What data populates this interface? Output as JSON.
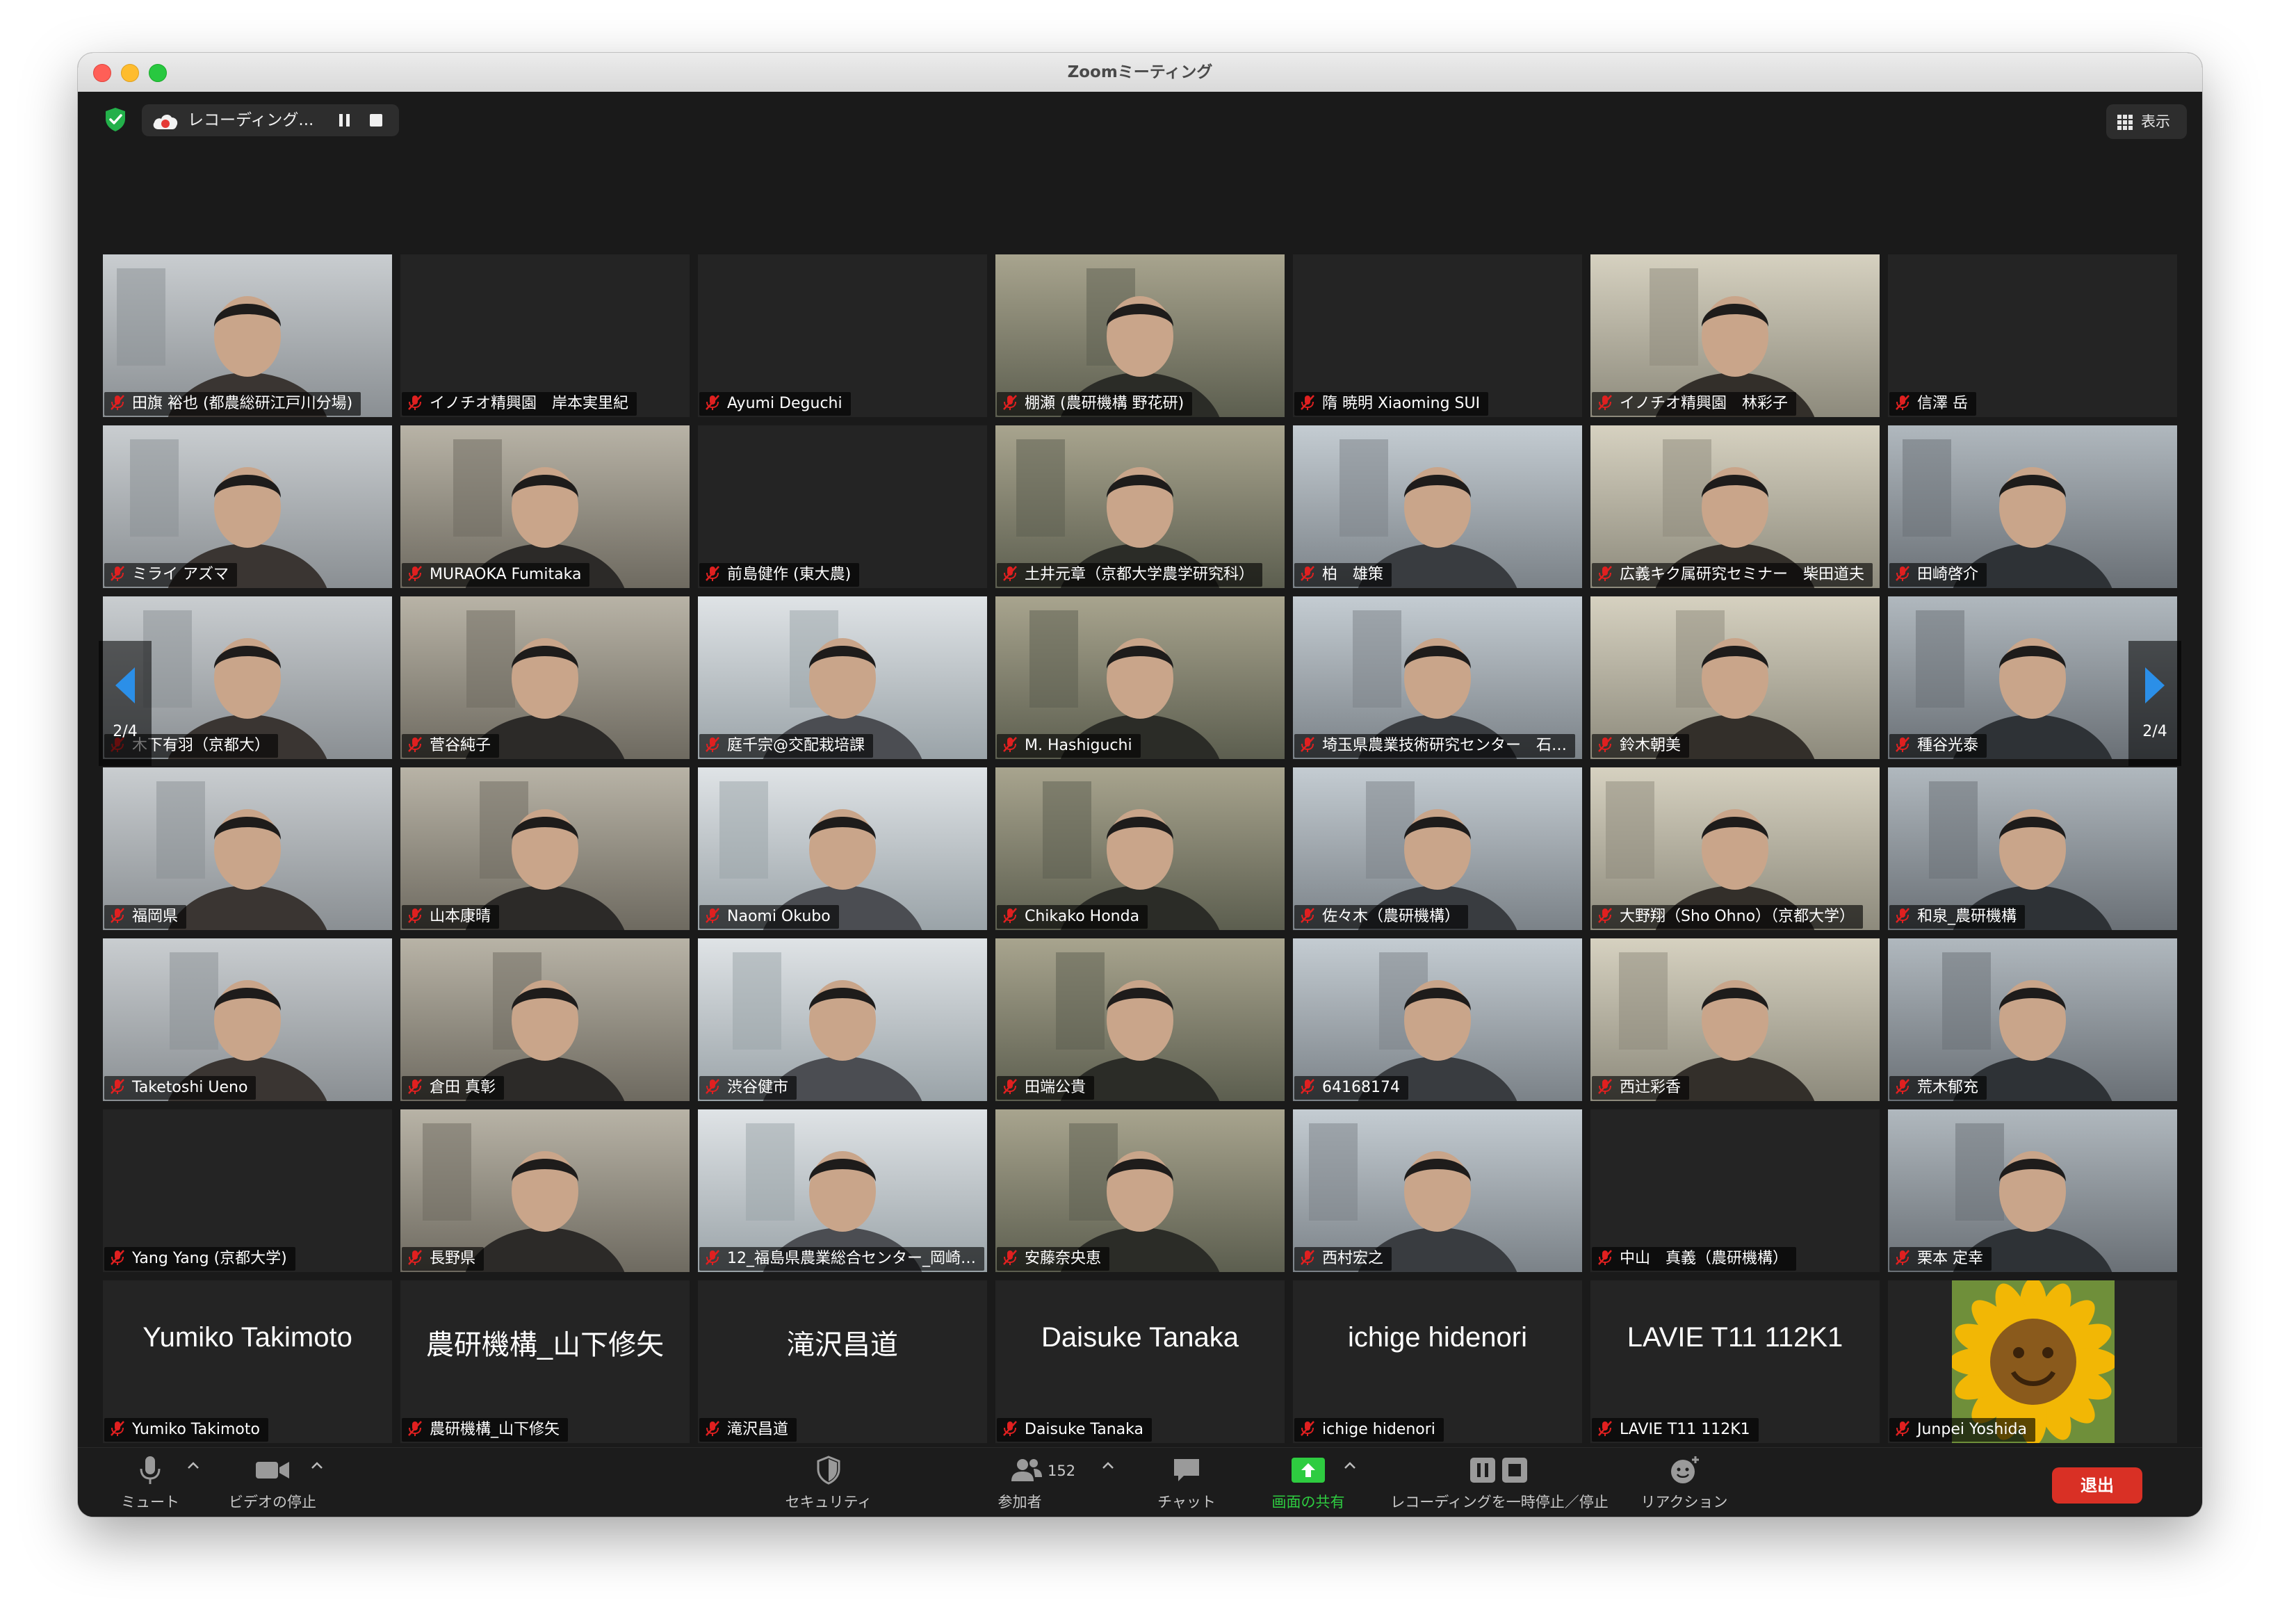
{
  "window": {
    "title": "Zoomミーティング"
  },
  "topbar": {
    "recording_label": "レコーディング...",
    "view_label": "表示"
  },
  "navigation": {
    "page_indicator_left": "2/4",
    "page_indicator_right": "2/4"
  },
  "participants": [
    {
      "name": "田旗 裕也 (都農総研江戸川分場)",
      "video": true
    },
    {
      "name": "イノチオ精興園　岸本実里紀",
      "video": false
    },
    {
      "name": "Ayumi Deguchi",
      "video": false
    },
    {
      "name": "棚瀬 (農研機構 野花研)",
      "video": true
    },
    {
      "name": "隋 暁明 Xiaoming SUI",
      "video": false
    },
    {
      "name": "イノチオ精興園　林彩子",
      "video": true
    },
    {
      "name": "信澤 岳",
      "video": false
    },
    {
      "name": "ミライ アズマ",
      "video": true
    },
    {
      "name": "MURAOKA Fumitaka",
      "video": true
    },
    {
      "name": "前島健作 (東大農)",
      "video": false
    },
    {
      "name": "土井元章（京都大学農学研究科）",
      "video": true
    },
    {
      "name": "柏　雄策",
      "video": true
    },
    {
      "name": "広義キク属研究セミナー　柴田道夫",
      "video": true
    },
    {
      "name": "田崎啓介",
      "video": true
    },
    {
      "name": "木下有羽（京都大）",
      "video": true
    },
    {
      "name": "菅谷純子",
      "video": true
    },
    {
      "name": "庭千宗@交配栽培課",
      "video": true
    },
    {
      "name": "M. Hashiguchi",
      "video": true
    },
    {
      "name": "埼玉県農業技術研究センター　石…",
      "video": true
    },
    {
      "name": "鈴木朝美",
      "video": true
    },
    {
      "name": "種谷光泰",
      "video": true
    },
    {
      "name": "福岡県",
      "video": true
    },
    {
      "name": "山本康晴",
      "video": true
    },
    {
      "name": "Naomi Okubo",
      "video": true
    },
    {
      "name": "Chikako Honda",
      "video": true
    },
    {
      "name": "佐々木（農研機構）",
      "video": true
    },
    {
      "name": "大野翔（Sho Ohno）（京都大学）",
      "video": true
    },
    {
      "name": "和泉_農研機構",
      "video": true
    },
    {
      "name": "Taketoshi Ueno",
      "video": true
    },
    {
      "name": "倉田 真彰",
      "video": true
    },
    {
      "name": "渋谷健市",
      "video": true
    },
    {
      "name": "田端公貴",
      "video": true
    },
    {
      "name": "64168174",
      "video": true
    },
    {
      "name": "西辻彩香",
      "video": true
    },
    {
      "name": "荒木郁充",
      "video": true
    },
    {
      "name": "Yang Yang (京都大学)",
      "video": false
    },
    {
      "name": "長野県",
      "video": true
    },
    {
      "name": "12_福島県農業総合センター_岡崎…",
      "video": true
    },
    {
      "name": "安藤奈央恵",
      "video": true
    },
    {
      "name": "西村宏之",
      "video": true
    },
    {
      "name": "中山　真義（農研機構）",
      "video": false
    },
    {
      "name": "栗本 定幸",
      "video": true
    },
    {
      "name": "Yumiko Takimoto",
      "video": false,
      "display": "Yumiko Takimoto"
    },
    {
      "name": "農研機構_山下修矢",
      "video": false,
      "display": "農研機構_山下修矢"
    },
    {
      "name": "滝沢昌道",
      "video": false,
      "display": "滝沢昌道"
    },
    {
      "name": "Daisuke Tanaka",
      "video": false,
      "display": "Daisuke Tanaka"
    },
    {
      "name": "ichige hidenori",
      "video": false,
      "display": "ichige hidenori"
    },
    {
      "name": "LAVIE T11 112K1",
      "video": false,
      "display": "LAVIE T11 112K1"
    },
    {
      "name": "Junpei Yoshida",
      "video": false,
      "avatar": "sunflower"
    }
  ],
  "toolbar": {
    "mute": "ミュート",
    "video": "ビデオの停止",
    "security": "セキュリティ",
    "participants": "参加者",
    "participants_count": "152",
    "chat": "チャット",
    "share": "画面の共有",
    "recording": "レコーディングを一時停止／停止",
    "reactions": "リアクション",
    "leave": "退出"
  },
  "colors": {
    "share_green": "#2ecc40",
    "leave_red": "#d93025",
    "arrow_blue": "#2b8fe8",
    "muted_red": "#e02020"
  }
}
